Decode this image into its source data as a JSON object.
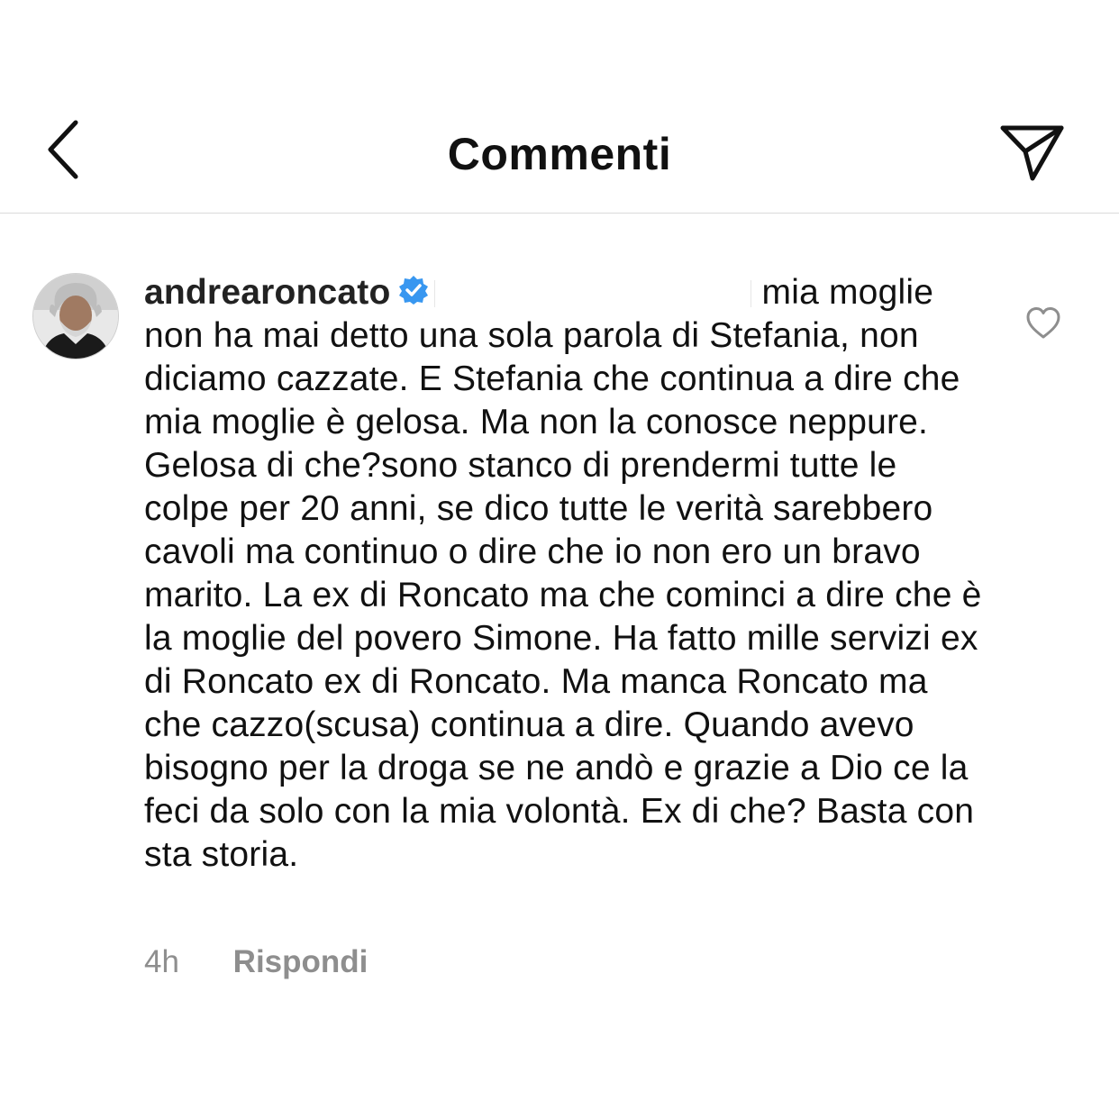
{
  "header": {
    "title": "Commenti",
    "back_icon": "chevron-left-icon",
    "share_icon": "paper-plane-icon"
  },
  "comment": {
    "username": "andrearoncato",
    "verified_icon": "verified-badge-icon",
    "text": "mia moglie non ha mai detto una sola parola di Stefania, non diciamo cazzate. E Stefania che continua a dire che mia moglie è gelosa. Ma non la conosce neppure. Gelosa di che?sono stanco di prendermi tutte le colpe per 20 anni, se dico tutte le verità sarebbero cavoli ma continuo o dire che io non ero un bravo marito. La ex di Roncato ma che cominci a dire che è la moglie del povero Simone. Ha fatto mille servizi ex di Roncato ex di Roncato. Ma manca Roncato ma che cazzo(scusa) continua a dire. Quando avevo bisogno per la droga se ne andò e grazie a Dio ce la feci da solo con la mia volontà. Ex di che? Basta con sta storia.",
    "time": "4h",
    "reply_label": "Rispondi",
    "like_icon": "heart-outline-icon"
  },
  "colors": {
    "text": "#111111",
    "secondary_text": "#8e8e8e",
    "verified_blue": "#3897f0",
    "divider": "#dbdbdb"
  }
}
